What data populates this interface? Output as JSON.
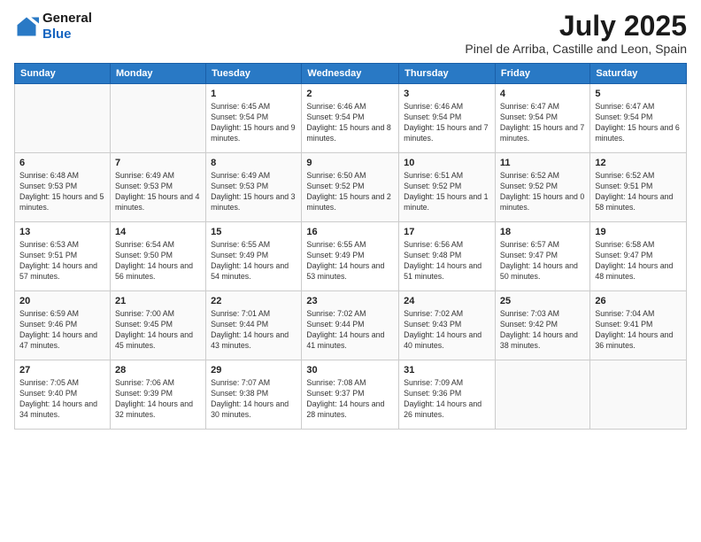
{
  "logo": {
    "line1": "General",
    "line2": "Blue"
  },
  "title": "July 2025",
  "location": "Pinel de Arriba, Castille and Leon, Spain",
  "weekdays": [
    "Sunday",
    "Monday",
    "Tuesday",
    "Wednesday",
    "Thursday",
    "Friday",
    "Saturday"
  ],
  "weeks": [
    [
      {
        "day": "",
        "sunrise": "",
        "sunset": "",
        "daylight": ""
      },
      {
        "day": "",
        "sunrise": "",
        "sunset": "",
        "daylight": ""
      },
      {
        "day": "1",
        "sunrise": "Sunrise: 6:45 AM",
        "sunset": "Sunset: 9:54 PM",
        "daylight": "Daylight: 15 hours and 9 minutes."
      },
      {
        "day": "2",
        "sunrise": "Sunrise: 6:46 AM",
        "sunset": "Sunset: 9:54 PM",
        "daylight": "Daylight: 15 hours and 8 minutes."
      },
      {
        "day": "3",
        "sunrise": "Sunrise: 6:46 AM",
        "sunset": "Sunset: 9:54 PM",
        "daylight": "Daylight: 15 hours and 7 minutes."
      },
      {
        "day": "4",
        "sunrise": "Sunrise: 6:47 AM",
        "sunset": "Sunset: 9:54 PM",
        "daylight": "Daylight: 15 hours and 7 minutes."
      },
      {
        "day": "5",
        "sunrise": "Sunrise: 6:47 AM",
        "sunset": "Sunset: 9:54 PM",
        "daylight": "Daylight: 15 hours and 6 minutes."
      }
    ],
    [
      {
        "day": "6",
        "sunrise": "Sunrise: 6:48 AM",
        "sunset": "Sunset: 9:53 PM",
        "daylight": "Daylight: 15 hours and 5 minutes."
      },
      {
        "day": "7",
        "sunrise": "Sunrise: 6:49 AM",
        "sunset": "Sunset: 9:53 PM",
        "daylight": "Daylight: 15 hours and 4 minutes."
      },
      {
        "day": "8",
        "sunrise": "Sunrise: 6:49 AM",
        "sunset": "Sunset: 9:53 PM",
        "daylight": "Daylight: 15 hours and 3 minutes."
      },
      {
        "day": "9",
        "sunrise": "Sunrise: 6:50 AM",
        "sunset": "Sunset: 9:52 PM",
        "daylight": "Daylight: 15 hours and 2 minutes."
      },
      {
        "day": "10",
        "sunrise": "Sunrise: 6:51 AM",
        "sunset": "Sunset: 9:52 PM",
        "daylight": "Daylight: 15 hours and 1 minute."
      },
      {
        "day": "11",
        "sunrise": "Sunrise: 6:52 AM",
        "sunset": "Sunset: 9:52 PM",
        "daylight": "Daylight: 15 hours and 0 minutes."
      },
      {
        "day": "12",
        "sunrise": "Sunrise: 6:52 AM",
        "sunset": "Sunset: 9:51 PM",
        "daylight": "Daylight: 14 hours and 58 minutes."
      }
    ],
    [
      {
        "day": "13",
        "sunrise": "Sunrise: 6:53 AM",
        "sunset": "Sunset: 9:51 PM",
        "daylight": "Daylight: 14 hours and 57 minutes."
      },
      {
        "day": "14",
        "sunrise": "Sunrise: 6:54 AM",
        "sunset": "Sunset: 9:50 PM",
        "daylight": "Daylight: 14 hours and 56 minutes."
      },
      {
        "day": "15",
        "sunrise": "Sunrise: 6:55 AM",
        "sunset": "Sunset: 9:49 PM",
        "daylight": "Daylight: 14 hours and 54 minutes."
      },
      {
        "day": "16",
        "sunrise": "Sunrise: 6:55 AM",
        "sunset": "Sunset: 9:49 PM",
        "daylight": "Daylight: 14 hours and 53 minutes."
      },
      {
        "day": "17",
        "sunrise": "Sunrise: 6:56 AM",
        "sunset": "Sunset: 9:48 PM",
        "daylight": "Daylight: 14 hours and 51 minutes."
      },
      {
        "day": "18",
        "sunrise": "Sunrise: 6:57 AM",
        "sunset": "Sunset: 9:47 PM",
        "daylight": "Daylight: 14 hours and 50 minutes."
      },
      {
        "day": "19",
        "sunrise": "Sunrise: 6:58 AM",
        "sunset": "Sunset: 9:47 PM",
        "daylight": "Daylight: 14 hours and 48 minutes."
      }
    ],
    [
      {
        "day": "20",
        "sunrise": "Sunrise: 6:59 AM",
        "sunset": "Sunset: 9:46 PM",
        "daylight": "Daylight: 14 hours and 47 minutes."
      },
      {
        "day": "21",
        "sunrise": "Sunrise: 7:00 AM",
        "sunset": "Sunset: 9:45 PM",
        "daylight": "Daylight: 14 hours and 45 minutes."
      },
      {
        "day": "22",
        "sunrise": "Sunrise: 7:01 AM",
        "sunset": "Sunset: 9:44 PM",
        "daylight": "Daylight: 14 hours and 43 minutes."
      },
      {
        "day": "23",
        "sunrise": "Sunrise: 7:02 AM",
        "sunset": "Sunset: 9:44 PM",
        "daylight": "Daylight: 14 hours and 41 minutes."
      },
      {
        "day": "24",
        "sunrise": "Sunrise: 7:02 AM",
        "sunset": "Sunset: 9:43 PM",
        "daylight": "Daylight: 14 hours and 40 minutes."
      },
      {
        "day": "25",
        "sunrise": "Sunrise: 7:03 AM",
        "sunset": "Sunset: 9:42 PM",
        "daylight": "Daylight: 14 hours and 38 minutes."
      },
      {
        "day": "26",
        "sunrise": "Sunrise: 7:04 AM",
        "sunset": "Sunset: 9:41 PM",
        "daylight": "Daylight: 14 hours and 36 minutes."
      }
    ],
    [
      {
        "day": "27",
        "sunrise": "Sunrise: 7:05 AM",
        "sunset": "Sunset: 9:40 PM",
        "daylight": "Daylight: 14 hours and 34 minutes."
      },
      {
        "day": "28",
        "sunrise": "Sunrise: 7:06 AM",
        "sunset": "Sunset: 9:39 PM",
        "daylight": "Daylight: 14 hours and 32 minutes."
      },
      {
        "day": "29",
        "sunrise": "Sunrise: 7:07 AM",
        "sunset": "Sunset: 9:38 PM",
        "daylight": "Daylight: 14 hours and 30 minutes."
      },
      {
        "day": "30",
        "sunrise": "Sunrise: 7:08 AM",
        "sunset": "Sunset: 9:37 PM",
        "daylight": "Daylight: 14 hours and 28 minutes."
      },
      {
        "day": "31",
        "sunrise": "Sunrise: 7:09 AM",
        "sunset": "Sunset: 9:36 PM",
        "daylight": "Daylight: 14 hours and 26 minutes."
      },
      {
        "day": "",
        "sunrise": "",
        "sunset": "",
        "daylight": ""
      },
      {
        "day": "",
        "sunrise": "",
        "sunset": "",
        "daylight": ""
      }
    ]
  ]
}
